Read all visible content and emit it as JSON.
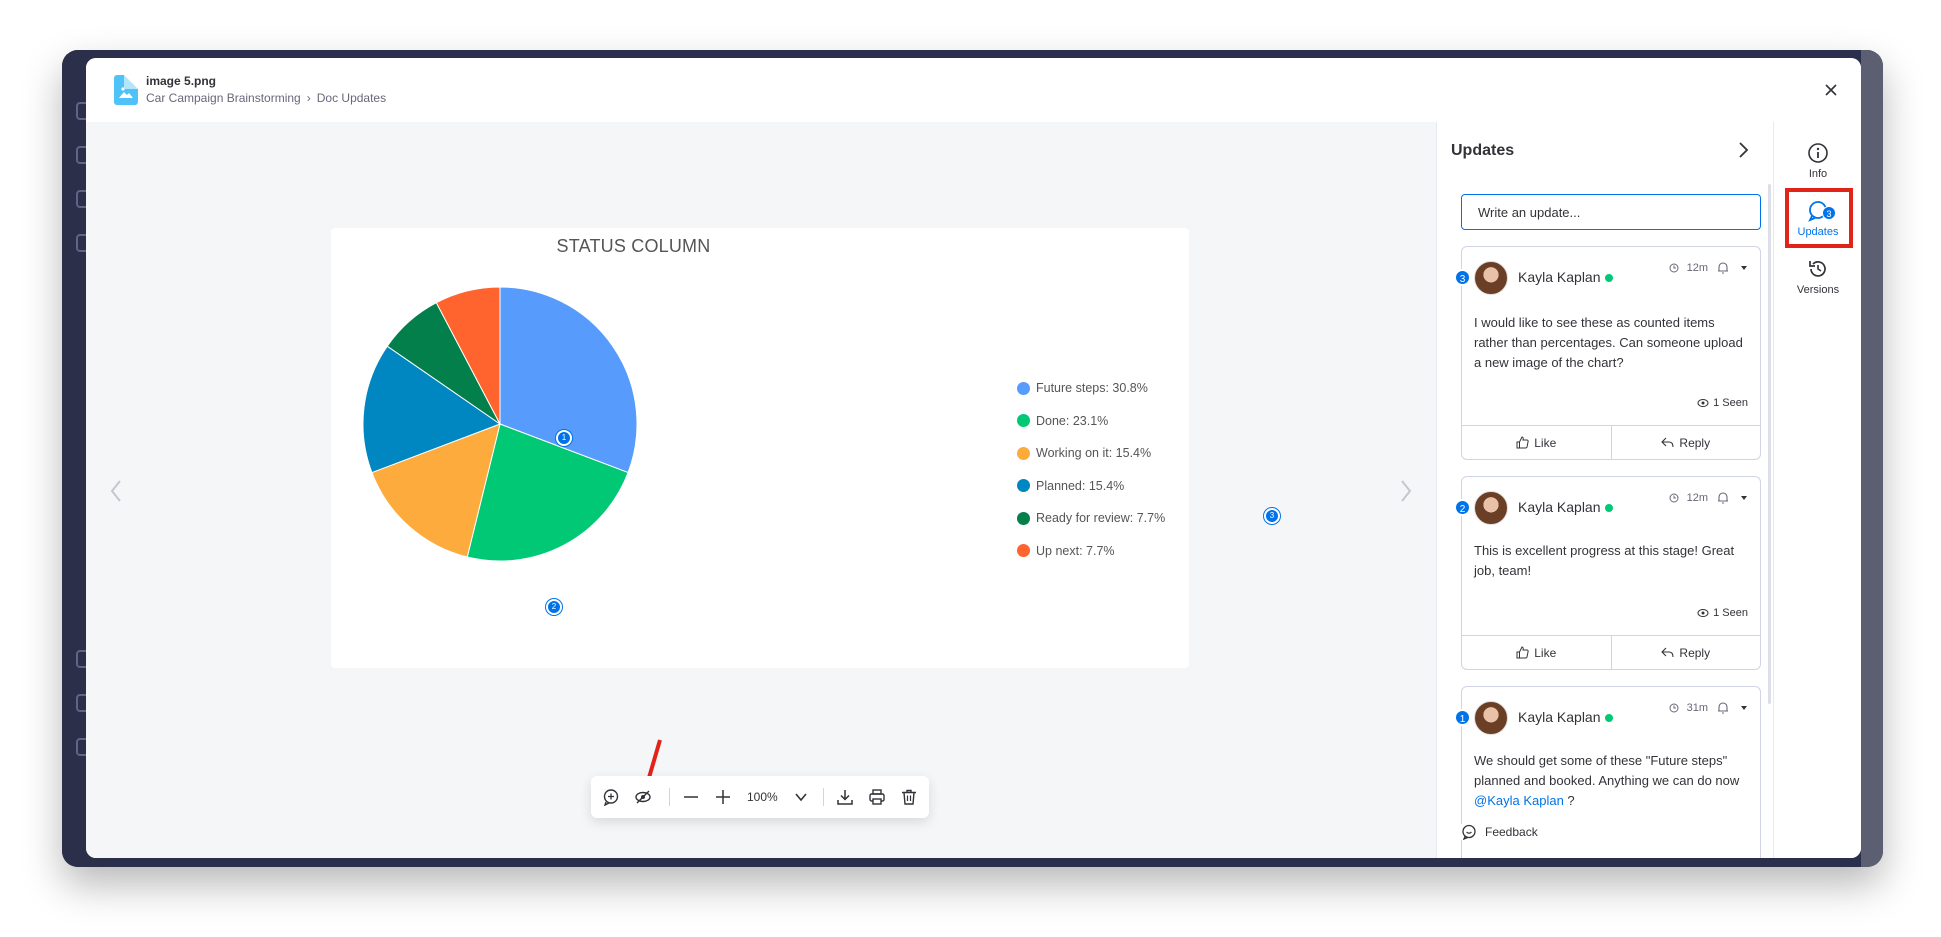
{
  "header": {
    "file_name": "image 5.png",
    "breadcrumb": [
      "Car Campaign Brainstorming",
      "Doc Updates"
    ]
  },
  "chart_data": {
    "type": "pie",
    "title": "STATUS COLUMN",
    "categories": [
      "Future steps",
      "Done",
      "Working on it",
      "Planned",
      "Ready for review",
      "Up next"
    ],
    "values": [
      30.8,
      23.1,
      15.4,
      15.4,
      7.7,
      7.7
    ],
    "colors": [
      "#579bfc",
      "#00c875",
      "#fdab3d",
      "#0086c0",
      "#037f4c",
      "#ff642e"
    ],
    "legend_labels": [
      "Future steps: 30.8%",
      "Done: 23.1%",
      "Working on it: 15.4%",
      "Planned: 15.4%",
      "Ready for review: 7.7%",
      "Up next: 7.7%"
    ],
    "legend_position": "right"
  },
  "pins": [
    "1",
    "2",
    "3"
  ],
  "toolbar": {
    "zoom": "100%",
    "icons": [
      "add-comment-icon",
      "hide-annotations-icon",
      "zoom-out-icon",
      "zoom-in-icon",
      "chevron-down-icon",
      "download-icon",
      "print-icon",
      "delete-icon"
    ]
  },
  "updates": {
    "title": "Updates",
    "write_placeholder": "Write an update...",
    "feedback_label": "Feedback",
    "items": [
      {
        "badge": "3",
        "author": "Kayla Kaplan",
        "time": "12m",
        "text": "I would like to see these as counted items rather than percentages. Can someone upload a new image of the chart?",
        "seen": "1 Seen",
        "like": "Like",
        "reply": "Reply"
      },
      {
        "badge": "2",
        "author": "Kayla Kaplan",
        "time": "12m",
        "text": "This is excellent progress at this stage! Great job, team!",
        "seen": "1 Seen",
        "like": "Like",
        "reply": "Reply"
      },
      {
        "badge": "1",
        "author": "Kayla Kaplan",
        "time": "31m",
        "text": "We should get some of these \"Future steps\" planned and booked. Anything we can do now ",
        "mention": "@Kayla Kaplan",
        "text_after": " ?"
      }
    ]
  },
  "side_tabs": {
    "info": "Info",
    "updates": "Updates",
    "updates_count": "3",
    "versions": "Versions"
  },
  "colors": {
    "accent": "#0073ea",
    "highlight_box": "#e2231a",
    "arrow": "#e2231a",
    "online": "#00c875"
  }
}
